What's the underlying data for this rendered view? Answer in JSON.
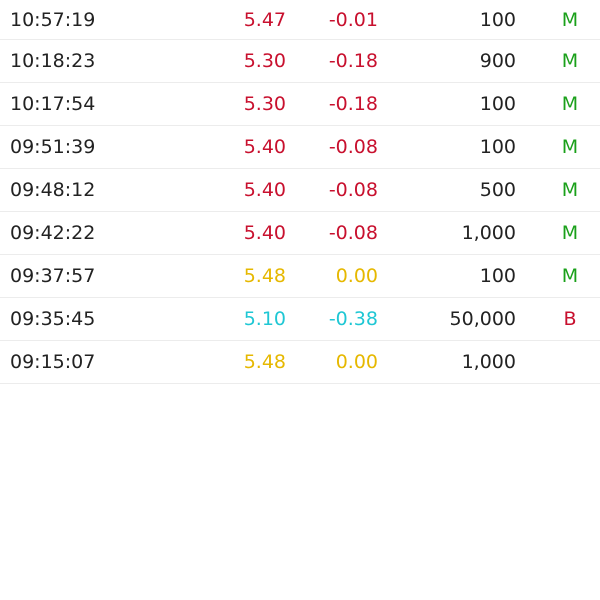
{
  "colors": {
    "down": "#c8102e",
    "flat": "#e6b800",
    "limit_down": "#1fc7d4",
    "flag_m": "#1aa01a",
    "flag_b": "#c8102e",
    "text": "#222222"
  },
  "trades": [
    {
      "time": "10:57:19",
      "price": "5.47",
      "change": "-0.01",
      "volume": "100",
      "flag": "M",
      "tone": "down"
    },
    {
      "time": "10:18:23",
      "price": "5.30",
      "change": "-0.18",
      "volume": "900",
      "flag": "M",
      "tone": "down"
    },
    {
      "time": "10:17:54",
      "price": "5.30",
      "change": "-0.18",
      "volume": "100",
      "flag": "M",
      "tone": "down"
    },
    {
      "time": "09:51:39",
      "price": "5.40",
      "change": "-0.08",
      "volume": "100",
      "flag": "M",
      "tone": "down"
    },
    {
      "time": "09:48:12",
      "price": "5.40",
      "change": "-0.08",
      "volume": "500",
      "flag": "M",
      "tone": "down"
    },
    {
      "time": "09:42:22",
      "price": "5.40",
      "change": "-0.08",
      "volume": "1,000",
      "flag": "M",
      "tone": "down"
    },
    {
      "time": "09:37:57",
      "price": "5.48",
      "change": "0.00",
      "volume": "100",
      "flag": "M",
      "tone": "flat"
    },
    {
      "time": "09:35:45",
      "price": "5.10",
      "change": "-0.38",
      "volume": "50,000",
      "flag": "B",
      "tone": "limit"
    },
    {
      "time": "09:15:07",
      "price": "5.48",
      "change": "0.00",
      "volume": "1,000",
      "flag": "",
      "tone": "flat"
    }
  ]
}
